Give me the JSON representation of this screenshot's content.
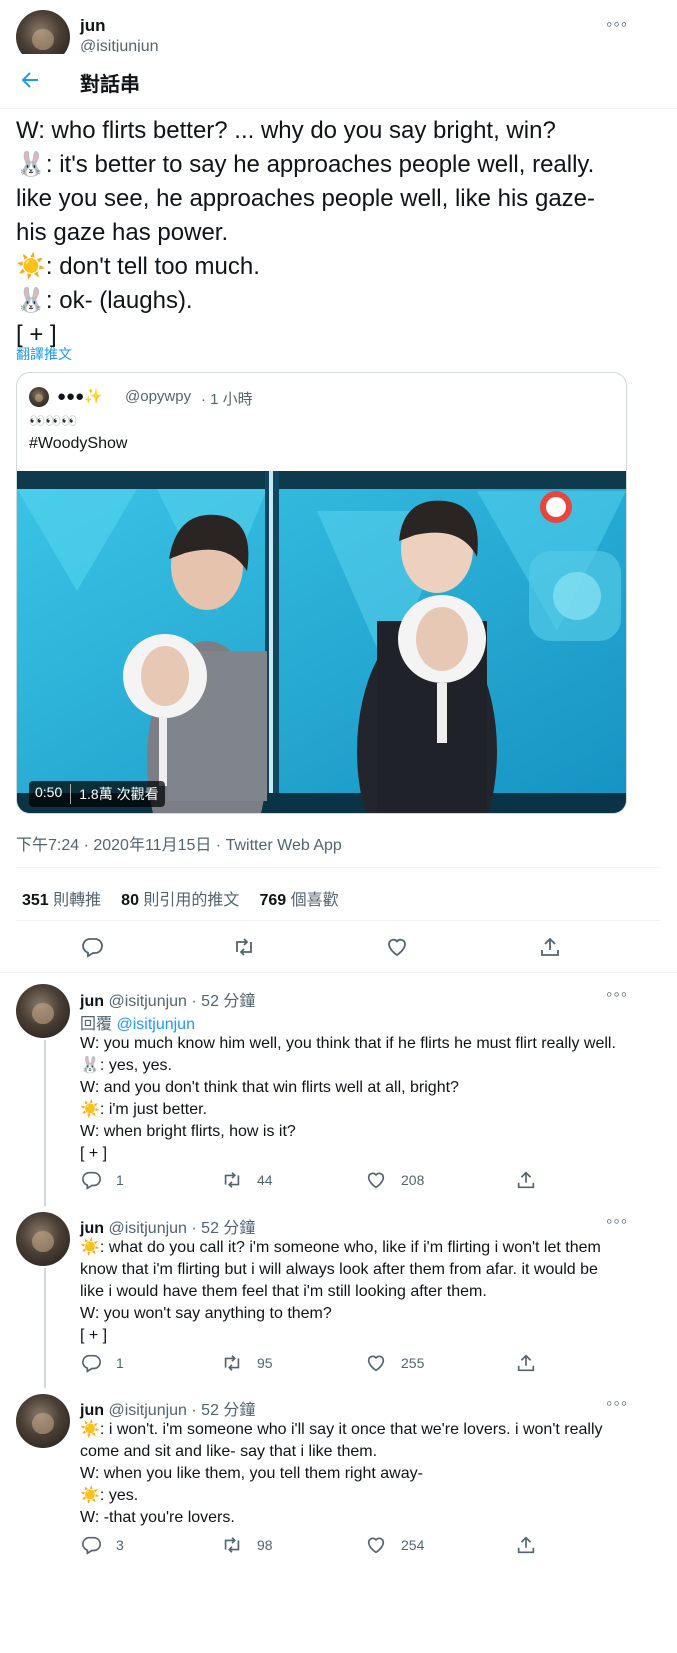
{
  "header": {
    "user_name": "jun",
    "user_handle": "@isitjunjun",
    "more": "◦◦◦",
    "back_icon": "arrow-left-icon",
    "title": "對話串"
  },
  "main_tweet": {
    "lines": [
      "W: who flirts better? ... why do you say bright, win?",
      "🐰: it's better to say he approaches people well, really.",
      "like you see, he approaches people well, like his gaze-",
      "his gaze has power.",
      "☀️: don't tell too much.",
      "🐰: ok- (laughs).",
      "[ + ]"
    ],
    "translate": "翻譯推文",
    "quote": {
      "name": "●●●✨",
      "handle": "@opywpy",
      "time": "· 1 小時",
      "line1": "👀👀👀",
      "line2": "#WoodyShow",
      "video_duration": "0:50",
      "video_views": "1.8萬 次觀看"
    },
    "timestamp": "下午7:24 · 2020年11月15日 · Twitter Web App",
    "stats": [
      {
        "count": "351",
        "label": "則轉推"
      },
      {
        "count": "80",
        "label": "則引用的推文"
      },
      {
        "count": "769",
        "label": "個喜歡"
      }
    ]
  },
  "replies": [
    {
      "name": "jun",
      "handle": "@isitjunjun",
      "time": "· 52 分鐘",
      "reply_to_prefix": "回覆",
      "reply_to": "@isitjunjun",
      "lines": [
        "W: you much know him well, you think that if he flirts he must flirt really well.",
        "🐰: yes, yes.",
        "W: and you don't think that win flirts well at all, bright?",
        "☀️: i'm just better.",
        "W: when bright flirts, how is it?",
        "[ + ]"
      ],
      "replies": "1",
      "retweets": "44",
      "likes": "208"
    },
    {
      "name": "jun",
      "handle": "@isitjunjun",
      "time": "· 52 分鐘",
      "lines": [
        "☀️: what do you call it? i'm someone who, like if i'm flirting i won't let them",
        "know that i'm flirting but i will always look after them from afar. it would be",
        "like i would have them feel that i'm still looking after them.",
        "W: you won't say anything to them?",
        "[ + ]"
      ],
      "replies": "1",
      "retweets": "95",
      "likes": "255"
    },
    {
      "name": "jun",
      "handle": "@isitjunjun",
      "time": "· 52 分鐘",
      "lines": [
        "☀️: i won't. i'm someone who i'll say it once that we're lovers. i won't really",
        "come and sit and like- say that i like them.",
        "W: when you like them, you tell them right away-",
        "☀️: yes.",
        "W: -that you're lovers."
      ],
      "replies": "3",
      "retweets": "98",
      "likes": "254"
    }
  ]
}
